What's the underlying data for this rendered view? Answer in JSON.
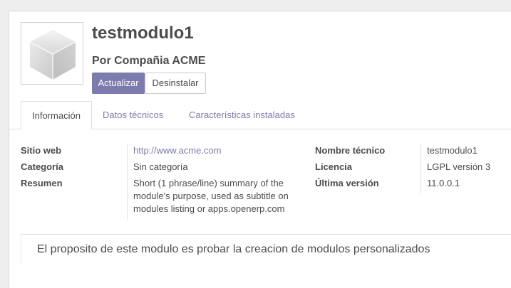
{
  "module": {
    "name": "testmodulo1",
    "author": "Por Compañia ACME",
    "icon": "module-cube-icon"
  },
  "actions": {
    "update_label": "Actualizar",
    "uninstall_label": "Desinstalar"
  },
  "tabs": [
    {
      "label": "Información",
      "active": true
    },
    {
      "label": "Datos técnicos",
      "active": false
    },
    {
      "label": "Características instaladas",
      "active": false
    }
  ],
  "info": {
    "left": [
      {
        "label": "Sitio web",
        "value": "http://www.acme.com"
      },
      {
        "label": "Categoría",
        "value": "Sin categoría"
      },
      {
        "label": "Resumen",
        "value": "Short (1 phrase/line) summary of the module's purpose, used as subtitle on modules listing or apps.openerp.com"
      }
    ],
    "right": [
      {
        "label": "Nombre técnico",
        "value": "testmodulo1"
      },
      {
        "label": "Licencia",
        "value": "LGPL versión 3"
      },
      {
        "label": "Última versión",
        "value": "11.0.0.1"
      }
    ]
  },
  "description": "El proposito de este modulo es probar la creacion de modulos personalizados",
  "colors": {
    "primary": "#7c7bad",
    "text": "#4c4c4c",
    "background": "#eeeeee"
  }
}
